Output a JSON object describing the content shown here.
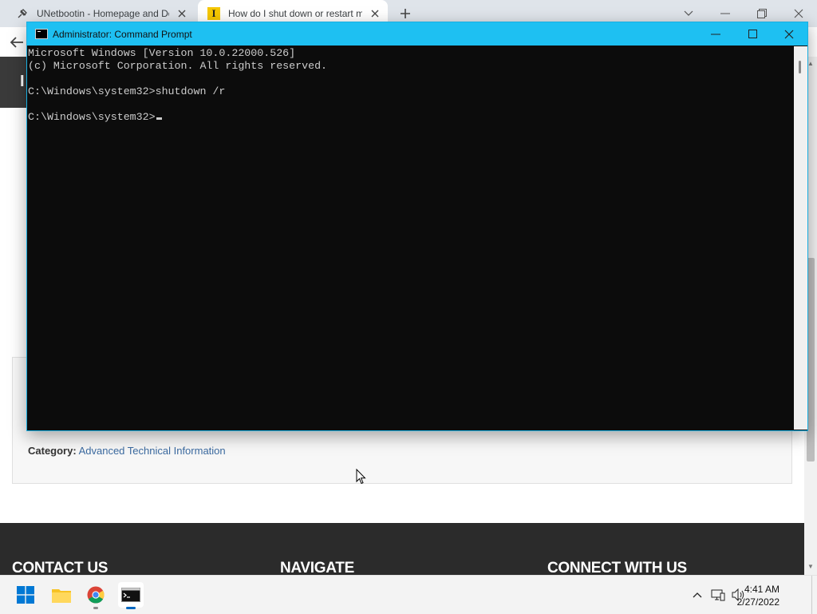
{
  "browser": {
    "tabs": [
      {
        "title": "UNetbootin - Homepage and Do",
        "icon": "unetbootin-favicon"
      },
      {
        "title": "How do I shut down or restart m",
        "icon": "infosec-favicon",
        "favicon_glyph": "I"
      }
    ]
  },
  "page": {
    "category_label": "Category:",
    "category_value": "Advanced Technical Information",
    "footer": {
      "contact": "CONTACT US",
      "navigate": "NAVIGATE",
      "connect": "CONNECT WITH US"
    }
  },
  "cmd": {
    "title": "Administrator: Command Prompt",
    "lines": [
      "Microsoft Windows [Version 10.0.22000.526]",
      "(c) Microsoft Corporation. All rights reserved.",
      "",
      "C:\\Windows\\system32>shutdown /r",
      "",
      "C:\\Windows\\system32>"
    ]
  },
  "taskbar": {
    "time": "4:41 AM",
    "date": "2/27/2022"
  },
  "colors": {
    "cmd_title_bar": "#1ec0f2",
    "console_bg": "#0c0c0c",
    "console_text": "#cccccc",
    "link": "#3b6aa0",
    "footer_bg": "#2b2b2b"
  }
}
